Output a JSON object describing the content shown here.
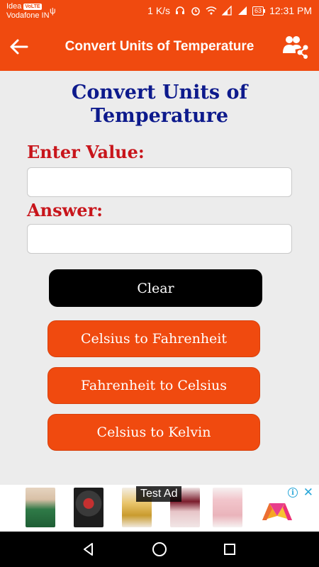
{
  "status_bar": {
    "carrier_1": "Idea",
    "volte": "VoLTE",
    "carrier_2": "Vodafone IN",
    "network_speed": "1 K/s",
    "battery": "63",
    "time": "12:31 PM"
  },
  "app_bar": {
    "title": "Convert Units of Temperature"
  },
  "content": {
    "heading_line1": "Convert Units of",
    "heading_line2": "Temperature",
    "enter_label": "Enter Value:",
    "value_input": "",
    "answer_label": "Answer:",
    "answer_input": ""
  },
  "buttons": {
    "clear": "Clear",
    "c_to_f": "Celsius to Fahrenheit",
    "f_to_c": "Fahrenheit to Celsius",
    "c_to_k": "Celsius to Kelvin"
  },
  "ad": {
    "label": "Test Ad",
    "info": "i",
    "close": "✕"
  },
  "colors": {
    "primary": "#f04a0f",
    "heading": "#0d1a8c",
    "label": "#c8151b",
    "clear_button": "#000000"
  }
}
